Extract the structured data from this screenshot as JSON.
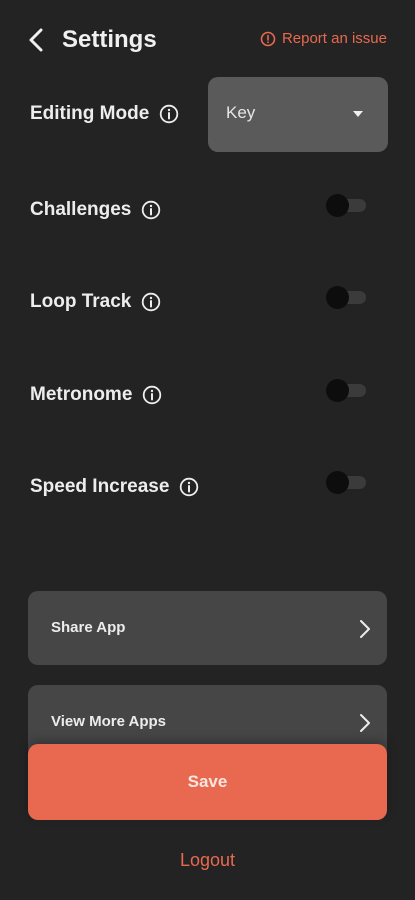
{
  "header": {
    "title": "Settings",
    "report_label": "Report an issue"
  },
  "settings": {
    "editing_mode": {
      "label": "Editing Mode",
      "value": "Key"
    },
    "challenges": {
      "label": "Challenges",
      "enabled": false
    },
    "loop_track": {
      "label": "Loop Track",
      "enabled": false
    },
    "metronome": {
      "label": "Metronome",
      "enabled": false
    },
    "speed_increase": {
      "label": "Speed Increase",
      "enabled": false
    }
  },
  "links": {
    "share": "Share App",
    "more_apps": "View More Apps"
  },
  "actions": {
    "save": "Save",
    "logout": "Logout"
  },
  "colors": {
    "background": "#232323",
    "accent": "#e8694f",
    "card": "#464646",
    "dropdown": "#5a5a5a"
  }
}
